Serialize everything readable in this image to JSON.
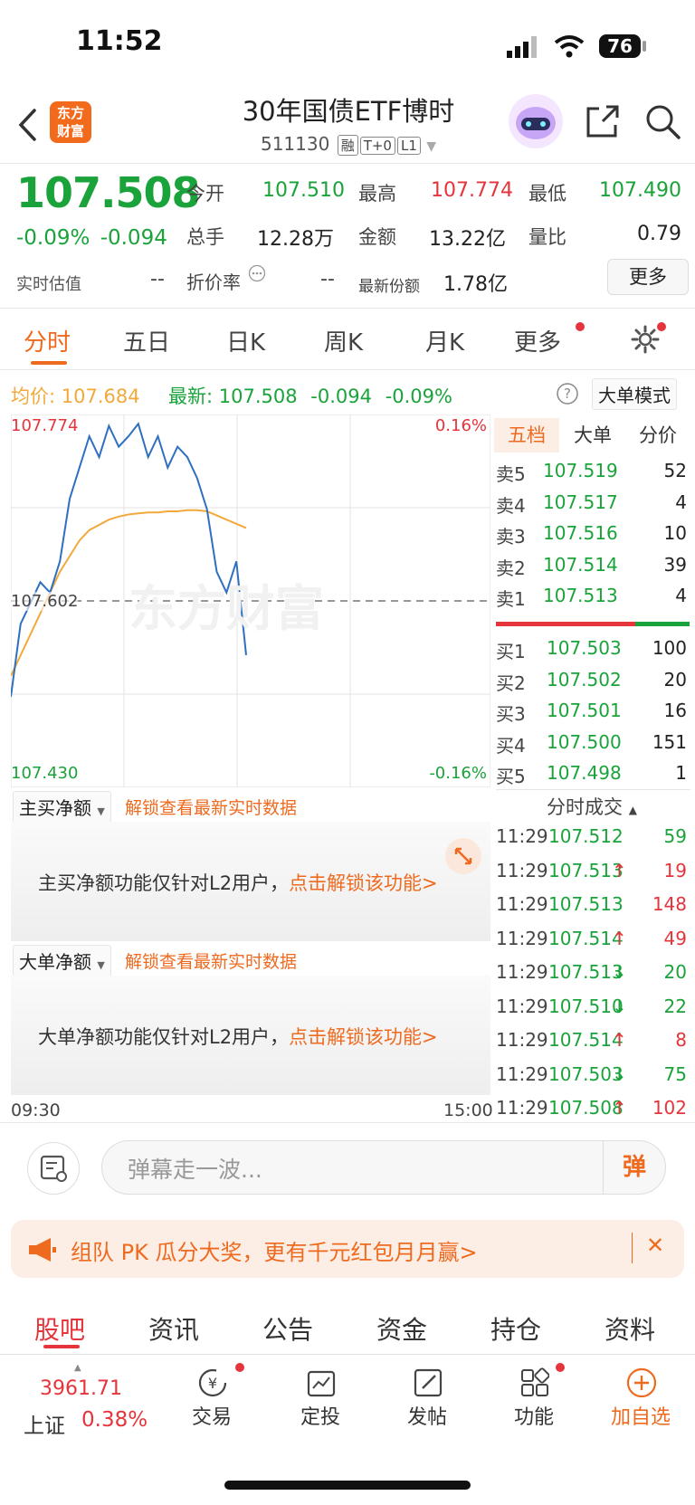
{
  "status": {
    "time": "11:52",
    "battery": "76"
  },
  "header": {
    "logo": "东方\n财富",
    "title": "30年国债ETF博时",
    "code": "511130",
    "tags": [
      "融",
      "T+0",
      "L1"
    ]
  },
  "quote": {
    "price": "107.508",
    "change_pct": "-0.09%",
    "change": "-0.094",
    "realtime_est_label": "实时估值",
    "realtime_est_value": "--",
    "stats": [
      {
        "label": "今开",
        "value": "107.510"
      },
      {
        "label": "最高",
        "value": "107.774"
      },
      {
        "label": "最低",
        "value": "107.490"
      },
      {
        "label": "总手",
        "value": "12.28万"
      },
      {
        "label": "金额",
        "value": "13.22亿"
      },
      {
        "label": "量比",
        "value": "0.79"
      },
      {
        "label": "折价率",
        "value": "--"
      },
      {
        "label": "最新份额",
        "value": "1.78亿"
      }
    ],
    "more_label": "更多"
  },
  "tabs": [
    "分时",
    "五日",
    "日K",
    "周K",
    "月K",
    "更多"
  ],
  "info_line": {
    "avg_label": "均价:",
    "avg_value": "107.684",
    "latest_label": "最新:",
    "latest_value": "107.508",
    "latest_change": "-0.094",
    "latest_pct": "-0.09%",
    "big_order_mode": "大单模式"
  },
  "chart": {
    "high_label": "107.774",
    "high_pct": "0.16%",
    "ref_label": "107.602",
    "low_label": "107.430",
    "low_pct": "-0.16%",
    "start_time": "09:30",
    "end_time": "15:00",
    "watermark": "东方财富"
  },
  "chart_data": {
    "type": "line",
    "y_range": [
      107.43,
      107.774
    ],
    "reference": 107.602,
    "series": [
      {
        "name": "均价",
        "values": [
          107.53,
          107.55,
          107.57,
          107.59,
          107.61,
          107.63,
          107.645,
          107.66,
          107.67,
          107.675,
          107.68,
          107.683,
          107.685,
          107.686,
          107.687,
          107.687,
          107.688,
          107.688,
          107.689,
          107.689,
          107.688,
          107.684,
          107.68,
          107.676,
          107.672
        ]
      },
      {
        "name": "最新",
        "values": [
          107.51,
          107.58,
          107.6,
          107.62,
          107.61,
          107.64,
          107.7,
          107.73,
          107.76,
          107.74,
          107.77,
          107.75,
          107.76,
          107.772,
          107.74,
          107.76,
          107.73,
          107.75,
          107.74,
          107.72,
          107.69,
          107.63,
          107.61,
          107.64,
          107.55
        ]
      }
    ]
  },
  "order_book": {
    "tabs": [
      "五档",
      "大单",
      "分价"
    ],
    "asks": [
      {
        "label": "卖5",
        "price": "107.519",
        "vol": "52"
      },
      {
        "label": "卖4",
        "price": "107.517",
        "vol": "4"
      },
      {
        "label": "卖3",
        "price": "107.516",
        "vol": "10"
      },
      {
        "label": "卖2",
        "price": "107.514",
        "vol": "39"
      },
      {
        "label": "卖1",
        "price": "107.513",
        "vol": "4"
      }
    ],
    "bids": [
      {
        "label": "买1",
        "price": "107.503",
        "vol": "100"
      },
      {
        "label": "买2",
        "price": "107.502",
        "vol": "20"
      },
      {
        "label": "买3",
        "price": "107.501",
        "vol": "16"
      },
      {
        "label": "买4",
        "price": "107.500",
        "vol": "151"
      },
      {
        "label": "买5",
        "price": "107.498",
        "vol": "1"
      }
    ],
    "trades_title": "分时成交",
    "trades": [
      {
        "time": "11:29",
        "price": "107.512",
        "arrow": "",
        "vol": "59",
        "color": "green"
      },
      {
        "time": "11:29",
        "price": "107.513",
        "arrow": "↑",
        "vol": "19",
        "color": "red"
      },
      {
        "time": "11:29",
        "price": "107.513",
        "arrow": "",
        "vol": "148",
        "color": "red"
      },
      {
        "time": "11:29",
        "price": "107.514",
        "arrow": "↑",
        "vol": "49",
        "color": "red"
      },
      {
        "time": "11:29",
        "price": "107.513",
        "arrow": "↓",
        "vol": "20",
        "color": "green"
      },
      {
        "time": "11:29",
        "price": "107.510",
        "arrow": "↓",
        "vol": "22",
        "color": "green"
      },
      {
        "time": "11:29",
        "price": "107.514",
        "arrow": "↑",
        "vol": "8",
        "color": "red"
      },
      {
        "time": "11:29",
        "price": "107.503",
        "arrow": "↓",
        "vol": "75",
        "color": "green"
      },
      {
        "time": "11:29",
        "price": "107.508",
        "arrow": "↑",
        "vol": "102",
        "color": "red"
      }
    ]
  },
  "sections": {
    "main_net": {
      "btn": "主买净额",
      "unlock": "解锁查看最新实时数据",
      "msg": "主买净额功能仅针对L2用户，",
      "link": "点击解锁该功能>"
    },
    "big_net": {
      "btn": "大单净额",
      "unlock": "解锁查看最新实时数据",
      "msg": "大单净额功能仅针对L2用户，",
      "link": "点击解锁该功能>"
    }
  },
  "danmu": {
    "placeholder": "弹幕走一波...",
    "btn": "弹"
  },
  "promo": {
    "text": "组队 PK 瓜分大奖，更有千元红包月月赢>",
    "close": "✕"
  },
  "bottom_tabs": [
    "股吧",
    "资讯",
    "公告",
    "资金",
    "持仓",
    "资料"
  ],
  "toolbar": {
    "index_value": "3961.71",
    "index_name": "上证",
    "index_pct": "0.38%",
    "items": [
      "交易",
      "定投",
      "发帖",
      "功能",
      "加自选"
    ]
  }
}
